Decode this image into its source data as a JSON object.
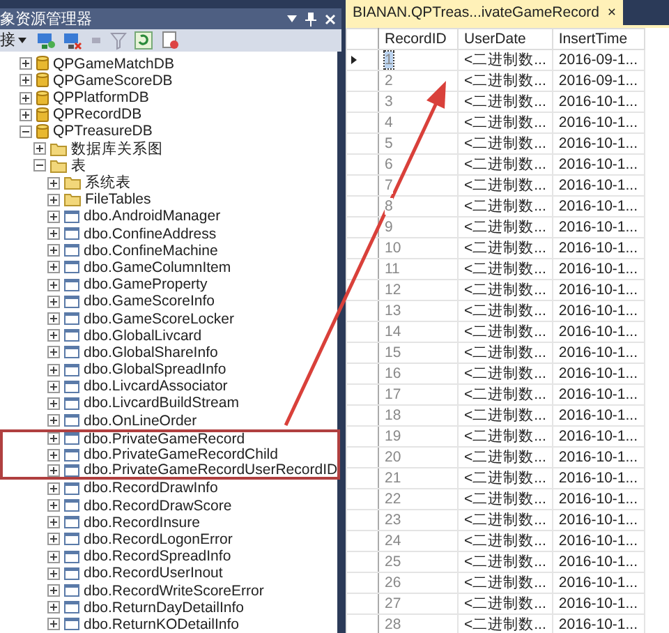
{
  "object_explorer": {
    "title": "象资源管理器",
    "toolbar": {
      "connect_label": "接"
    },
    "tree": [
      {
        "label": "QPGameMatchDB",
        "kind": "database",
        "expanded": false,
        "highlighted": false
      },
      {
        "label": "QPGameScoreDB",
        "kind": "database",
        "expanded": false,
        "highlighted": false
      },
      {
        "label": "QPPlatformDB",
        "kind": "database",
        "expanded": false,
        "highlighted": false
      },
      {
        "label": "QPRecordDB",
        "kind": "database",
        "expanded": false,
        "highlighted": false
      },
      {
        "label": "QPTreasureDB",
        "kind": "database",
        "expanded": true,
        "highlighted": false,
        "children": [
          {
            "label": "数据库关系图",
            "kind": "folder",
            "expanded": false,
            "highlighted": false
          },
          {
            "label": "表",
            "kind": "folder",
            "expanded": true,
            "highlighted": false,
            "children": [
              {
                "label": "系统表",
                "kind": "folder",
                "expanded": false,
                "highlighted": false
              },
              {
                "label": "FileTables",
                "kind": "folder",
                "expanded": false,
                "highlighted": false
              },
              {
                "label": "dbo.AndroidManager",
                "kind": "table",
                "expanded": false,
                "highlighted": false
              },
              {
                "label": "dbo.ConfineAddress",
                "kind": "table",
                "expanded": false,
                "highlighted": false
              },
              {
                "label": "dbo.ConfineMachine",
                "kind": "table",
                "expanded": false,
                "highlighted": false
              },
              {
                "label": "dbo.GameColumnItem",
                "kind": "table",
                "expanded": false,
                "highlighted": false
              },
              {
                "label": "dbo.GameProperty",
                "kind": "table",
                "expanded": false,
                "highlighted": false
              },
              {
                "label": "dbo.GameScoreInfo",
                "kind": "table",
                "expanded": false,
                "highlighted": false
              },
              {
                "label": "dbo.GameScoreLocker",
                "kind": "table",
                "expanded": false,
                "highlighted": false
              },
              {
                "label": "dbo.GlobalLivcard",
                "kind": "table",
                "expanded": false,
                "highlighted": false
              },
              {
                "label": "dbo.GlobalShareInfo",
                "kind": "table",
                "expanded": false,
                "highlighted": false
              },
              {
                "label": "dbo.GlobalSpreadInfo",
                "kind": "table",
                "expanded": false,
                "highlighted": false
              },
              {
                "label": "dbo.LivcardAssociator",
                "kind": "table",
                "expanded": false,
                "highlighted": false
              },
              {
                "label": "dbo.LivcardBuildStream",
                "kind": "table",
                "expanded": false,
                "highlighted": false
              },
              {
                "label": "dbo.OnLineOrder",
                "kind": "table",
                "expanded": false,
                "highlighted": false
              },
              {
                "label": "dbo.PrivateGameRecord",
                "kind": "table",
                "expanded": false,
                "highlighted": true
              },
              {
                "label": "dbo.PrivateGameRecordChild",
                "kind": "table",
                "expanded": false,
                "highlighted": true
              },
              {
                "label": "dbo.PrivateGameRecordUserRecordID",
                "kind": "table",
                "expanded": false,
                "highlighted": true
              },
              {
                "label": "dbo.RecordDrawInfo",
                "kind": "table",
                "expanded": false,
                "highlighted": false
              },
              {
                "label": "dbo.RecordDrawScore",
                "kind": "table",
                "expanded": false,
                "highlighted": false
              },
              {
                "label": "dbo.RecordInsure",
                "kind": "table",
                "expanded": false,
                "highlighted": false
              },
              {
                "label": "dbo.RecordLogonError",
                "kind": "table",
                "expanded": false,
                "highlighted": false
              },
              {
                "label": "dbo.RecordSpreadInfo",
                "kind": "table",
                "expanded": false,
                "highlighted": false
              },
              {
                "label": "dbo.RecordUserInout",
                "kind": "table",
                "expanded": false,
                "highlighted": false
              },
              {
                "label": "dbo.RecordWriteScoreError",
                "kind": "table",
                "expanded": false,
                "highlighted": false
              },
              {
                "label": "dbo.ReturnDayDetailInfo",
                "kind": "table",
                "expanded": false,
                "highlighted": false
              },
              {
                "label": "dbo.ReturnKODetailInfo",
                "kind": "table",
                "expanded": false,
                "highlighted": false
              }
            ]
          }
        ]
      }
    ]
  },
  "results": {
    "tab": {
      "title": "BIANAN.QPTreas...ivateGameRecord",
      "close": "×",
      "selected": true
    },
    "columns": [
      "RecordID",
      "UserDate",
      "InsertTime"
    ],
    "rows": [
      {
        "cells": [
          "1",
          "<二进制数...",
          "2016-09-1..."
        ],
        "current": true
      },
      {
        "cells": [
          "2",
          "<二进制数...",
          "2016-09-1..."
        ],
        "current": false
      },
      {
        "cells": [
          "3",
          "<二进制数...",
          "2016-10-1..."
        ],
        "current": false
      },
      {
        "cells": [
          "4",
          "<二进制数...",
          "2016-10-1..."
        ],
        "current": false
      },
      {
        "cells": [
          "5",
          "<二进制数...",
          "2016-10-1..."
        ],
        "current": false
      },
      {
        "cells": [
          "6",
          "<二进制数...",
          "2016-10-1..."
        ],
        "current": false
      },
      {
        "cells": [
          "7",
          "<二进制数...",
          "2016-10-1..."
        ],
        "current": false
      },
      {
        "cells": [
          "8",
          "<二进制数...",
          "2016-10-1..."
        ],
        "current": false
      },
      {
        "cells": [
          "9",
          "<二进制数...",
          "2016-10-1..."
        ],
        "current": false
      },
      {
        "cells": [
          "10",
          "<二进制数...",
          "2016-10-1..."
        ],
        "current": false
      },
      {
        "cells": [
          "11",
          "<二进制数...",
          "2016-10-1..."
        ],
        "current": false
      },
      {
        "cells": [
          "12",
          "<二进制数...",
          "2016-10-1..."
        ],
        "current": false
      },
      {
        "cells": [
          "13",
          "<二进制数...",
          "2016-10-1..."
        ],
        "current": false
      },
      {
        "cells": [
          "14",
          "<二进制数...",
          "2016-10-1..."
        ],
        "current": false
      },
      {
        "cells": [
          "15",
          "<二进制数...",
          "2016-10-1..."
        ],
        "current": false
      },
      {
        "cells": [
          "16",
          "<二进制数...",
          "2016-10-1..."
        ],
        "current": false
      },
      {
        "cells": [
          "17",
          "<二进制数...",
          "2016-10-1..."
        ],
        "current": false
      },
      {
        "cells": [
          "18",
          "<二进制数...",
          "2016-10-1..."
        ],
        "current": false
      },
      {
        "cells": [
          "19",
          "<二进制数...",
          "2016-10-1..."
        ],
        "current": false
      },
      {
        "cells": [
          "20",
          "<二进制数...",
          "2016-10-1..."
        ],
        "current": false
      },
      {
        "cells": [
          "21",
          "<二进制数...",
          "2016-10-1..."
        ],
        "current": false
      },
      {
        "cells": [
          "22",
          "<二进制数...",
          "2016-10-1..."
        ],
        "current": false
      },
      {
        "cells": [
          "23",
          "<二进制数...",
          "2016-10-1..."
        ],
        "current": false
      },
      {
        "cells": [
          "24",
          "<二进制数...",
          "2016-10-1..."
        ],
        "current": false
      },
      {
        "cells": [
          "25",
          "<二进制数...",
          "2016-10-1..."
        ],
        "current": false
      },
      {
        "cells": [
          "26",
          "<二进制数...",
          "2016-10-1..."
        ],
        "current": false
      },
      {
        "cells": [
          "27",
          "<二进制数...",
          "2016-10-1..."
        ],
        "current": false
      },
      {
        "cells": [
          "28",
          "<二进制数...",
          "2016-10-1..."
        ],
        "current": false
      }
    ]
  }
}
